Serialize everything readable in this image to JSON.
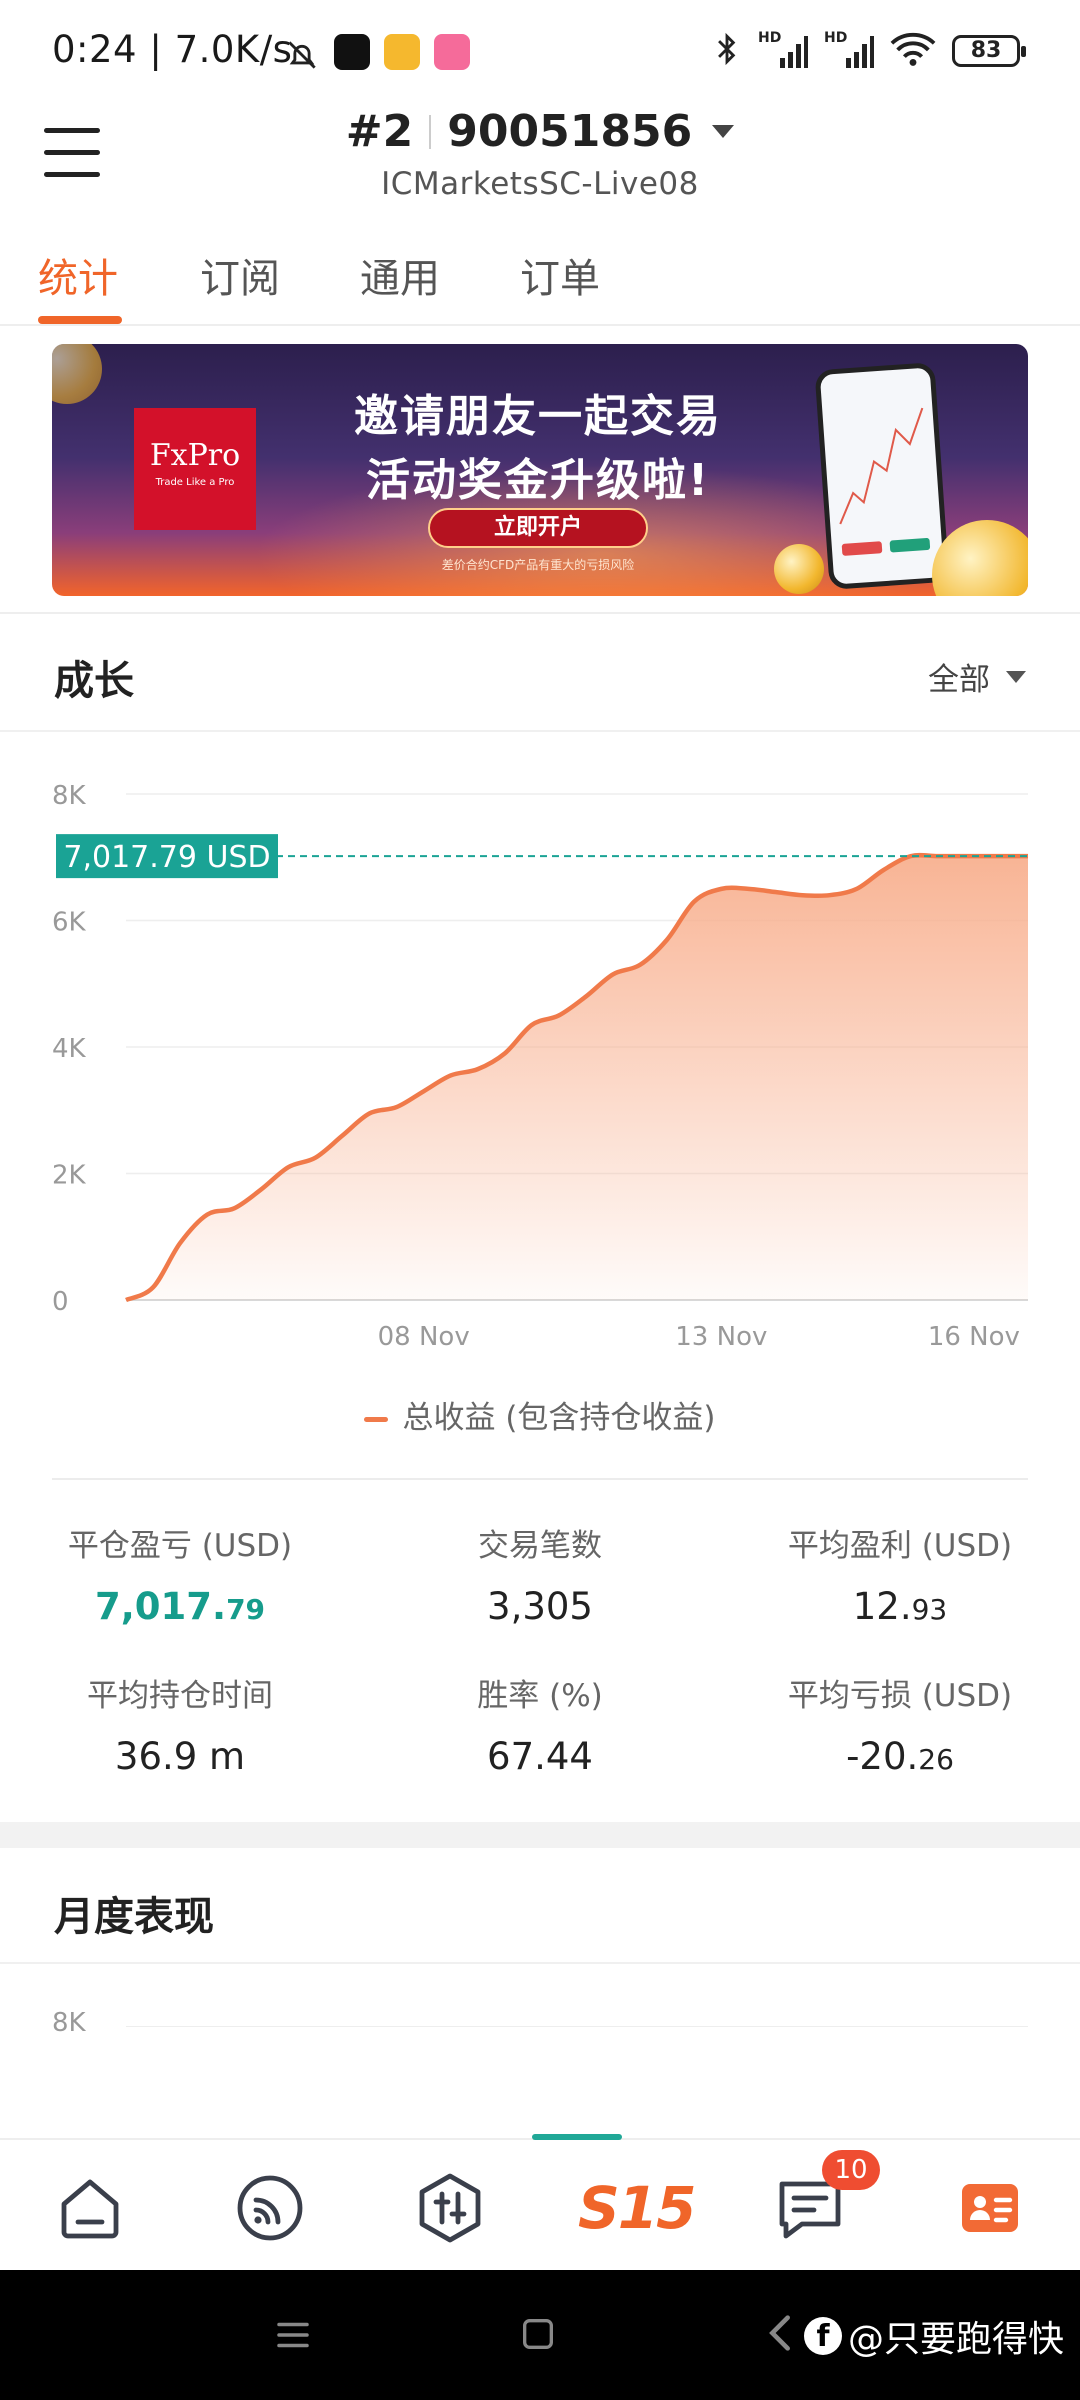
{
  "status_bar": {
    "time": "0:24",
    "speed": "7.0K/s",
    "battery": "83",
    "hd_1": "HD",
    "hd_2": "HD"
  },
  "header": {
    "account_index": "#2",
    "account_number": "90051856",
    "server": "ICMarketsSC-Live08"
  },
  "tabs": [
    {
      "label": "统计",
      "active": true
    },
    {
      "label": "订阅",
      "active": false
    },
    {
      "label": "通用",
      "active": false
    },
    {
      "label": "订单",
      "active": false
    }
  ],
  "banner": {
    "brand": "FxPro",
    "brand_tagline": "Trade Like a Pro",
    "line1": "邀请朋友一起交易",
    "line2": "活动奖金升级啦!",
    "button": "立即开户",
    "note": "差价合约CFD产品有重大的亏损风险"
  },
  "growth": {
    "title": "成长",
    "range": "全部",
    "legend": "总收益 (包含持仓收益)"
  },
  "chart_data": {
    "type": "area",
    "y_ticks": [
      "0",
      "2K",
      "4K",
      "6K",
      "8K"
    ],
    "ylim": [
      0,
      8000
    ],
    "x_tick_labels": [
      "08 Nov",
      "13 Nov",
      "16 Nov"
    ],
    "x_tick_positions": [
      0.33,
      0.66,
      0.94
    ],
    "current_value_label": "7,017.79 USD",
    "current_value": 7017.79,
    "series": [
      {
        "x": [
          0,
          0.03,
          0.06,
          0.09,
          0.12,
          0.15,
          0.18,
          0.21,
          0.24,
          0.27,
          0.3,
          0.33,
          0.36,
          0.39,
          0.42,
          0.45,
          0.48,
          0.51,
          0.54,
          0.57,
          0.6,
          0.63,
          0.66,
          0.69,
          0.72,
          0.75,
          0.78,
          0.81,
          0.84,
          0.87,
          0.9,
          0.93,
          0.96,
          1.0
        ],
        "values": [
          0,
          200,
          900,
          1350,
          1450,
          1750,
          2100,
          2250,
          2600,
          2950,
          3050,
          3300,
          3550,
          3650,
          3900,
          4350,
          4500,
          4800,
          5150,
          5300,
          5700,
          6300,
          6500,
          6500,
          6450,
          6400,
          6400,
          6500,
          6800,
          7017.79,
          7017.79,
          7017.79,
          7017.79,
          7017.79
        ]
      }
    ],
    "colors": {
      "line": "#f07a4a",
      "fill_top": "#f8b08f",
      "current": "#1aa395"
    }
  },
  "stats": {
    "closed_pnl": {
      "label": "平仓盈亏 (USD)",
      "int": "7,017.",
      "dec": "79"
    },
    "trades": {
      "label": "交易笔数",
      "value": "3,305"
    },
    "avg_profit": {
      "label": "平均盈利 (USD)",
      "int": "12.",
      "dec": "93"
    },
    "avg_hold": {
      "label": "平均持仓时间",
      "value": "36.9 m"
    },
    "win_rate": {
      "label": "胜率 (%)",
      "value": "67.44"
    },
    "avg_loss": {
      "label": "平均亏损 (USD)",
      "int": "-20.",
      "dec": "26"
    }
  },
  "monthly": {
    "title": "月度表现",
    "axis_top": "8K"
  },
  "bottom_nav": {
    "signals_label": "S15",
    "messages_badge": "10",
    "items": [
      "home-icon",
      "feed-icon",
      "trade-icon",
      "signals-icon",
      "messages-icon",
      "account-icon"
    ]
  },
  "watermark": "@只要跑得快"
}
